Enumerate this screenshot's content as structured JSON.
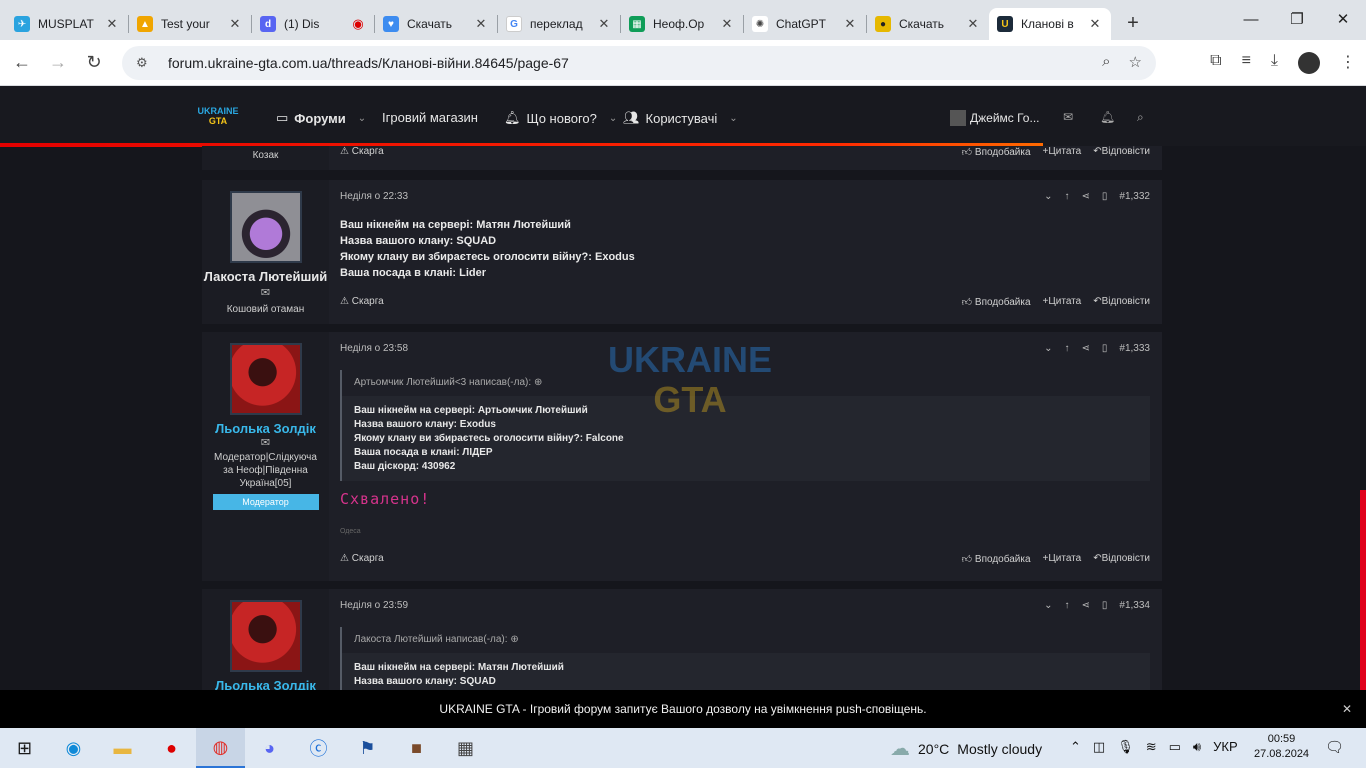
{
  "browser": {
    "tabs": [
      {
        "title": "MUSPLAT",
        "icon": "telegram-icon",
        "color": "#2aa3df",
        "active": false
      },
      {
        "title": "Test your",
        "icon": "bell-icon",
        "color": "#f0a500",
        "active": false
      },
      {
        "title": "(1) Dis",
        "icon": "discord-icon",
        "color": "#5865f2",
        "active": false
      },
      {
        "title": "Скачать",
        "icon": "heart-icon",
        "color": "#3d8cf0",
        "active": false
      },
      {
        "title": "переклад",
        "icon": "google-icon",
        "color": "#4285f4",
        "active": false
      },
      {
        "title": "Неоф.Ор",
        "icon": "sheets-icon",
        "color": "#0f9d58",
        "active": false
      },
      {
        "title": "ChatGPT",
        "icon": "chatgpt-icon",
        "color": "#444444",
        "active": false
      },
      {
        "title": "Скачать",
        "icon": "film-icon",
        "color": "#e6b800",
        "active": false
      },
      {
        "title": "Кланові в",
        "icon": "forum-icon",
        "color": "#1c2b3a",
        "active": true
      }
    ],
    "url": "forum.ukraine-gta.com.ua/threads/Кланові-війни.84645/page-67"
  },
  "forum": {
    "logo": {
      "top": "UKRAINE",
      "bottom": "GTA"
    },
    "nav": {
      "forums": "Форуми",
      "shop": "Ігровий магазин",
      "whats_new": "Що нового?",
      "users": "Користувачі",
      "username": "Джеймс Го..."
    },
    "prev_footer": {
      "author_title": "Козак",
      "report": "Скарга",
      "like": "Вподобайка",
      "quote": "Цитата",
      "reply": "Відповісти"
    }
  },
  "posts": [
    {
      "author": "Лакоста Лютейший",
      "role": "Кошовий отаман",
      "date": "Неділя о 22:33",
      "number": "#1,332",
      "lines": [
        "Ваш нікнейм на сервері: Матян Лютейший",
        "Назва вашого клану: SQUAD",
        "Якому клану ви збираєтесь оголосити війну?: Exodus",
        "Ваша посада в клані: Lider"
      ],
      "report": "Скарга",
      "like": "Вподобайка",
      "quote": "Цитата",
      "reply": "Відповісти"
    },
    {
      "author": "Льолька Золдік",
      "role": "Модератор|Слідкуюча за Неоф|Південна Україна[05]",
      "badge": "Модератор",
      "date": "Неділя о 23:58",
      "number": "#1,333",
      "quote_head": "Артьомчик Лютейший<3 написав(-ла):",
      "quote_lines": [
        "Ваш нікнейм на сервері: Артьомчик Лютейший",
        "Назва вашого клану: Exodus",
        "Якому клану ви збираєтесь оголосити війну?: Falcone",
        "Ваша посада в клані: ЛІДЕР",
        "Ваш діскорд: 430962"
      ],
      "approved": "Схвалено!",
      "tiny_tag": "Одеса",
      "report": "Скарга",
      "like": "Вподобайка",
      "quote": "Цитата",
      "reply": "Відповісти"
    },
    {
      "author": "Льолька Золдік",
      "date": "Неділя о 23:59",
      "number": "#1,334",
      "quote_head": "Лакоста Лютейший написав(-ла):",
      "quote_lines": [
        "Ваш нікнейм на сервері: Матян Лютейший",
        "Назва вашого клану: SQUAD"
      ]
    }
  ],
  "watermark": {
    "top": "UKRAINE",
    "bottom": "GTA"
  },
  "push_notice": "UKRAINE GTA - Ігровий форум запитує Вашого дозволу на увімкнення push-сповіщень.",
  "taskbar": {
    "weather_temp": "20°C",
    "weather_text": "Mostly cloudy",
    "lang": "УКР",
    "time": "00:59",
    "date": "27.08.2024"
  }
}
